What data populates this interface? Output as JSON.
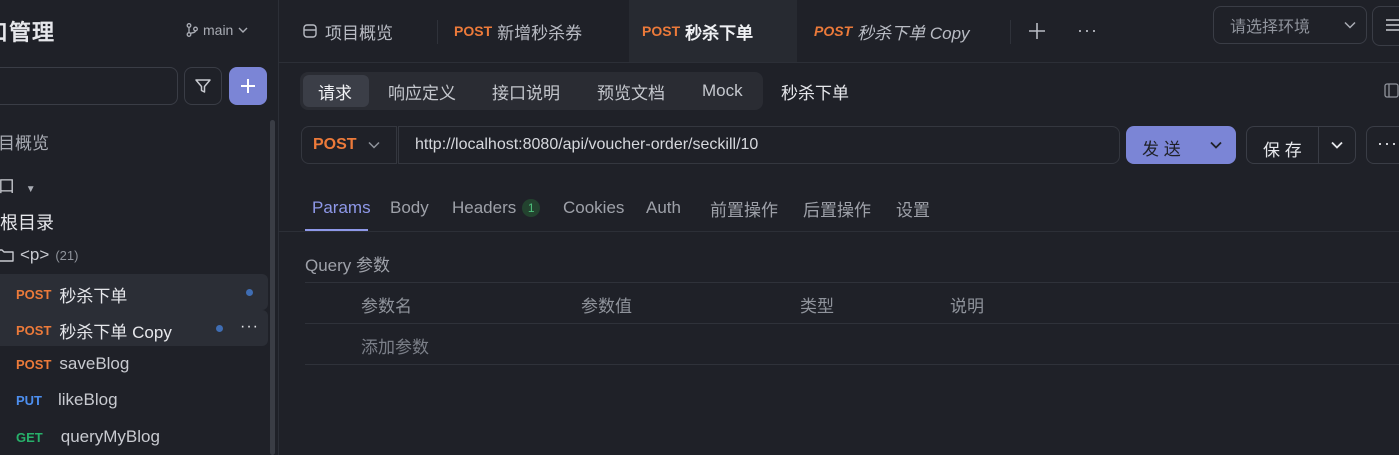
{
  "sidebar": {
    "title": "口管理",
    "branch": "main",
    "tree": {
      "overview": "目概览",
      "interfaces": "口",
      "root": "根目录",
      "folder": "<p>",
      "folder_count": "(21)"
    },
    "items": [
      {
        "method": "POST",
        "label": "秒杀下单"
      },
      {
        "method": "POST",
        "label": "秒杀下单 Copy"
      },
      {
        "method": "POST",
        "label": "saveBlog"
      },
      {
        "method": "PUT",
        "label": "likeBlog"
      },
      {
        "method": "GET",
        "label": "queryMyBlog"
      }
    ]
  },
  "tabs": [
    {
      "label": "项目概览"
    },
    {
      "method": "POST",
      "label": "新增秒杀券"
    },
    {
      "method": "POST",
      "label": "秒杀下单"
    },
    {
      "method": "POST",
      "label": "秒杀下单 Copy"
    }
  ],
  "env": {
    "placeholder": "请选择环境"
  },
  "subtabs": [
    "请求",
    "响应定义",
    "接口说明",
    "预览文档",
    "Mock"
  ],
  "endpoint_name": "秒杀下单",
  "request": {
    "method": "POST",
    "url": "http://localhost:8080/api/voucher-order/seckill/10",
    "send": "发 送",
    "save": "保 存"
  },
  "param_tabs": [
    "Params",
    "Body",
    "Headers",
    "Cookies",
    "Auth",
    "前置操作",
    "后置操作",
    "设置"
  ],
  "headers_count": "1",
  "query": {
    "label": "Query 参数",
    "columns": [
      "参数名",
      "参数值",
      "类型",
      "说明"
    ],
    "add": "添加参数"
  },
  "colors": {
    "accent": "#7b85d6",
    "post": "#ec7a3a",
    "put": "#4d8ff0",
    "get": "#27b06a"
  }
}
